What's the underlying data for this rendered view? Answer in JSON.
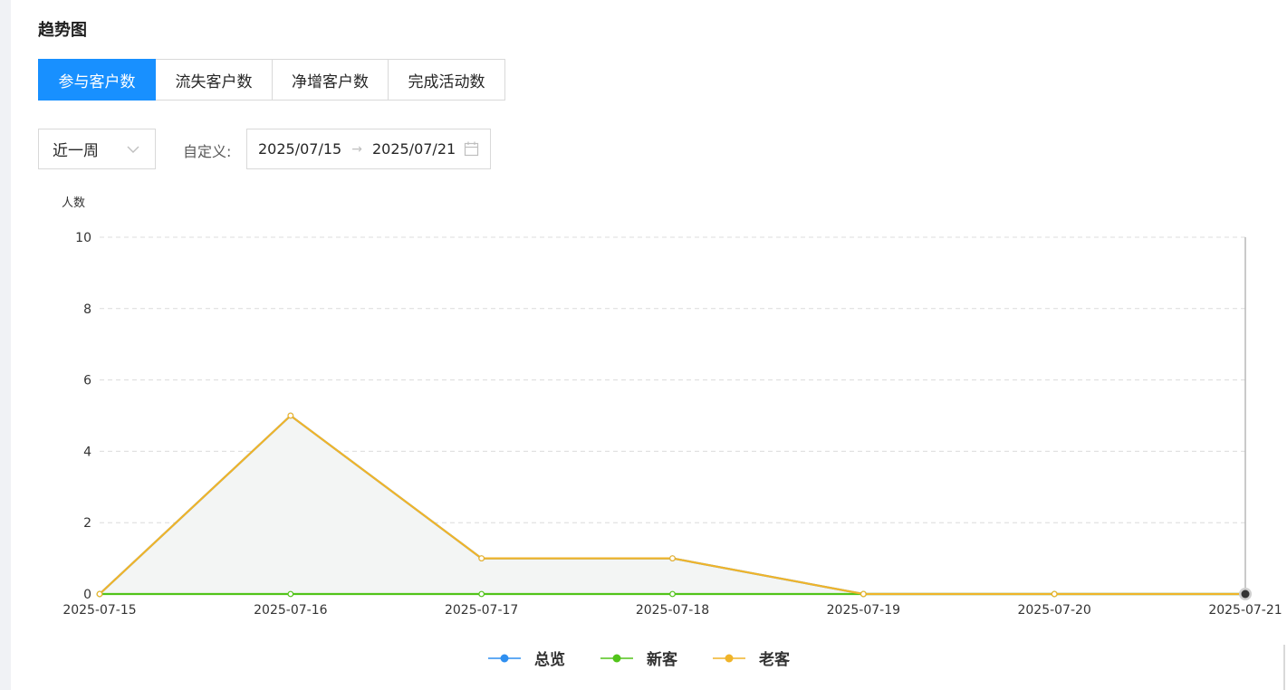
{
  "section_title": "趋势图",
  "tabs": [
    {
      "label": "参与客户数",
      "active": true
    },
    {
      "label": "流失客户数",
      "active": false
    },
    {
      "label": "净增客户数",
      "active": false
    },
    {
      "label": "完成活动数",
      "active": false
    }
  ],
  "filters": {
    "period_value": "近一周",
    "custom_label": "自定义:",
    "start_date": "2025/07/15",
    "end_date": "2025/07/21",
    "range_separator": "→"
  },
  "colors": {
    "accent": "#1890ff",
    "series_total": "#2f8ff0",
    "series_new": "#52c41a",
    "series_old": "#f0b429",
    "area_fill": "#f3f5f4"
  },
  "chart_data": {
    "type": "line",
    "ylabel": "人数",
    "ylim": [
      0,
      10
    ],
    "yticks": [
      0,
      2,
      4,
      6,
      8,
      10
    ],
    "grid": true,
    "legend_position": "bottom",
    "x": [
      "2025-07-15",
      "2025-07-16",
      "2025-07-17",
      "2025-07-18",
      "2025-07-19",
      "2025-07-20",
      "2025-07-21"
    ],
    "series": [
      {
        "name": "总览",
        "color": "#2f8ff0",
        "values": [
          0,
          5,
          1,
          1,
          0,
          0,
          0
        ]
      },
      {
        "name": "新客",
        "color": "#52c41a",
        "values": [
          0,
          0,
          0,
          0,
          0,
          0,
          0
        ]
      },
      {
        "name": "老客",
        "color": "#f0b429",
        "values": [
          0,
          5,
          1,
          1,
          0,
          0,
          0
        ]
      }
    ],
    "highlighted_index": 6
  }
}
